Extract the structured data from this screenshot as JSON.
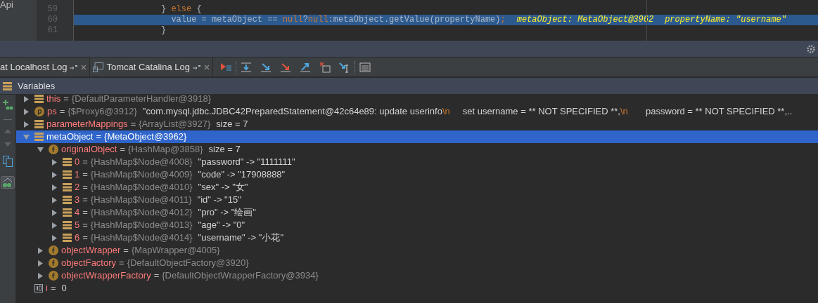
{
  "side_label": "Api",
  "code": {
    "lines": [
      {
        "number": "59",
        "highlighted": false,
        "segments": [
          {
            "kind": "plain",
            "text": "          } "
          },
          {
            "kind": "keyword",
            "text": "else"
          },
          {
            "kind": "plain",
            "text": " {"
          }
        ]
      },
      {
        "number": "60",
        "highlighted": true,
        "segments": [
          {
            "kind": "plain",
            "text": "            value = metaObject == "
          },
          {
            "kind": "keyword",
            "text": "null"
          },
          {
            "kind": "plain",
            "text": "?"
          },
          {
            "kind": "keyword",
            "text": "null"
          },
          {
            "kind": "plain",
            "text": ":metaObject.getValue(propertyName)"
          },
          {
            "kind": "keyword",
            "text": ";"
          },
          {
            "kind": "hint",
            "text": "metaObject: MetaObject@3962"
          },
          {
            "kind": "hint",
            "text": "propertyName: \"username\""
          }
        ]
      },
      {
        "number": "61",
        "highlighted": false,
        "segments": [
          {
            "kind": "plain",
            "text": "          }"
          }
        ]
      }
    ]
  },
  "tabs": [
    {
      "label": "at Localhost Log",
      "selected": false
    },
    {
      "label": "Tomcat Catalina Log",
      "selected": false
    }
  ],
  "panel_title": "Variables",
  "variables": [
    {
      "kind": "local",
      "name": "this",
      "sep": "=",
      "expanded": false,
      "selected": false,
      "type": "{DefaultParameterHandler@3918}"
    },
    {
      "kind": "param",
      "name": "ps",
      "sep": "=",
      "expanded": false,
      "selected": false,
      "type": "{$Proxy6@3912}",
      "value": [
        {
          "kind": "plain",
          "text": "\"com.mysql.jdbc.JDBC42PreparedStatement@42c64e89: update userinfo"
        },
        {
          "kind": "escape",
          "text": "\\n"
        },
        {
          "kind": "plain",
          "text": "     set username = ** NOT SPECIFIED **,"
        },
        {
          "kind": "escape",
          "text": "\\n"
        },
        {
          "kind": "plain",
          "text": "       password = ** NOT SPECIFIED **,.."
        }
      ]
    },
    {
      "kind": "local",
      "name": "parameterMappings",
      "sep": "=",
      "expanded": false,
      "selected": false,
      "type": "{ArrayList@3927}",
      "value": [
        {
          "kind": "plain",
          "text": "size = 7"
        }
      ]
    },
    {
      "kind": "local",
      "name": "metaObject",
      "sep": "=",
      "expanded": true,
      "selected": true,
      "type": "{MetaObject@3962}",
      "children": [
        {
          "kind": "field",
          "name": "originalObject",
          "sep": "=",
          "expanded": true,
          "selected": false,
          "type": "{HashMap@3858}",
          "value": [
            {
              "kind": "plain",
              "text": "size = 7"
            }
          ],
          "children": [
            {
              "kind": "local",
              "name": "0",
              "sep": "=",
              "expanded": false,
              "selected": false,
              "type": "{HashMap$Node@4008}",
              "value": [
                {
                  "kind": "plain",
                  "text": "\"password\" -> \"1111111\""
                }
              ]
            },
            {
              "kind": "local",
              "name": "1",
              "sep": "=",
              "expanded": false,
              "selected": false,
              "type": "{HashMap$Node@4009}",
              "value": [
                {
                  "kind": "plain",
                  "text": "\"code\" -> \"17908888\""
                }
              ]
            },
            {
              "kind": "local",
              "name": "2",
              "sep": "=",
              "expanded": false,
              "selected": false,
              "type": "{HashMap$Node@4010}",
              "value": [
                {
                  "kind": "plain",
                  "text": "\"sex\" -> \"女\""
                }
              ]
            },
            {
              "kind": "local",
              "name": "3",
              "sep": "=",
              "expanded": false,
              "selected": false,
              "type": "{HashMap$Node@4011}",
              "value": [
                {
                  "kind": "plain",
                  "text": "\"id\" -> \"15\""
                }
              ]
            },
            {
              "kind": "local",
              "name": "4",
              "sep": "=",
              "expanded": false,
              "selected": false,
              "type": "{HashMap$Node@4012}",
              "value": [
                {
                  "kind": "plain",
                  "text": "\"pro\" -> \"绘画\""
                }
              ]
            },
            {
              "kind": "local",
              "name": "5",
              "sep": "=",
              "expanded": false,
              "selected": false,
              "type": "{HashMap$Node@4013}",
              "value": [
                {
                  "kind": "plain",
                  "text": "\"age\" -> \"0\""
                }
              ]
            },
            {
              "kind": "local",
              "name": "6",
              "sep": "=",
              "expanded": false,
              "selected": false,
              "type": "{HashMap$Node@4014}",
              "value": [
                {
                  "kind": "plain",
                  "text": "\"username\" -> \"小花\""
                }
              ]
            }
          ]
        },
        {
          "kind": "field",
          "name": "objectWrapper",
          "sep": "=",
          "expanded": false,
          "selected": false,
          "type": "{MapWrapper@4005}"
        },
        {
          "kind": "field",
          "name": "objectFactory",
          "sep": "=",
          "expanded": false,
          "selected": false,
          "type": "{DefaultObjectFactory@3920}"
        },
        {
          "kind": "field",
          "name": "objectWrapperFactory",
          "sep": "=",
          "expanded": false,
          "selected": false,
          "type": "{DefaultObjectWrapperFactory@3934}"
        }
      ]
    },
    {
      "kind": "primitive",
      "name": "i",
      "sep": "=",
      "selected": false,
      "value": [
        {
          "kind": "plain",
          "text": "0"
        }
      ]
    }
  ]
}
